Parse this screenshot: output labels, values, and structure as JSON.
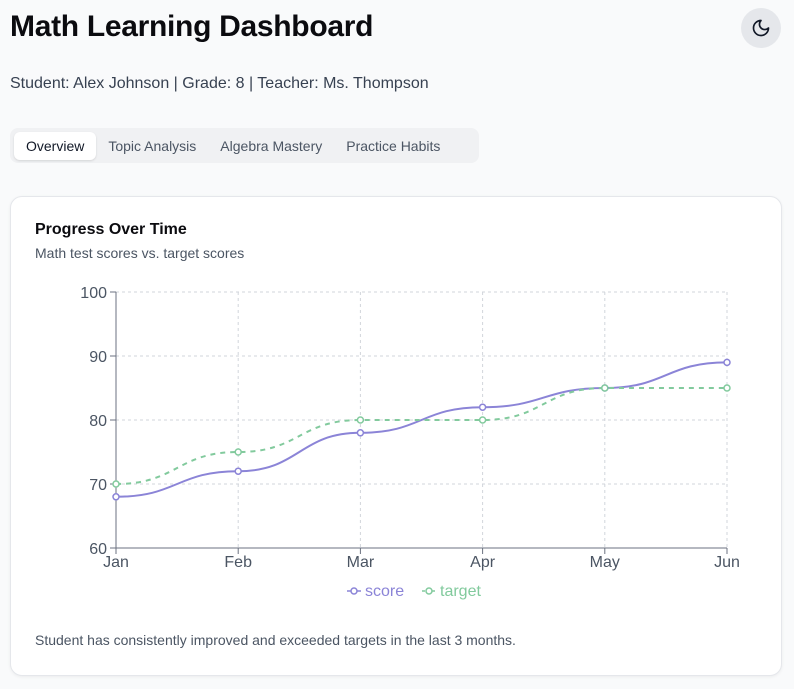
{
  "header": {
    "title": "Math Learning Dashboard",
    "subline": "Student: Alex Johnson | Grade: 8 | Teacher: Ms. Thompson",
    "theme_toggle_icon": "moon-icon"
  },
  "tabs": [
    {
      "label": "Overview",
      "active": true
    },
    {
      "label": "Topic Analysis",
      "active": false
    },
    {
      "label": "Algebra Mastery",
      "active": false
    },
    {
      "label": "Practice Habits",
      "active": false
    }
  ],
  "card": {
    "title": "Progress Over Time",
    "description": "Math test scores vs. target scores",
    "note": "Student has consistently improved and exceeded targets in the last 3 months."
  },
  "colors": {
    "score": "#8b84d7",
    "target": "#82ca9d",
    "grid": "#d1d5db",
    "axis": "#6b7280"
  },
  "chart_data": {
    "type": "line",
    "title": "",
    "xlabel": "",
    "ylabel": "",
    "categories": [
      "Jan",
      "Feb",
      "Mar",
      "Apr",
      "May",
      "Jun"
    ],
    "ylim": [
      60,
      100
    ],
    "yticks": [
      60,
      70,
      80,
      90,
      100
    ],
    "grid": true,
    "legend": "bottom",
    "series": [
      {
        "name": "score",
        "values": [
          68,
          72,
          78,
          82,
          85,
          89
        ],
        "style": "solid"
      },
      {
        "name": "target",
        "values": [
          70,
          75,
          80,
          80,
          85,
          85
        ],
        "style": "dashed"
      }
    ]
  }
}
